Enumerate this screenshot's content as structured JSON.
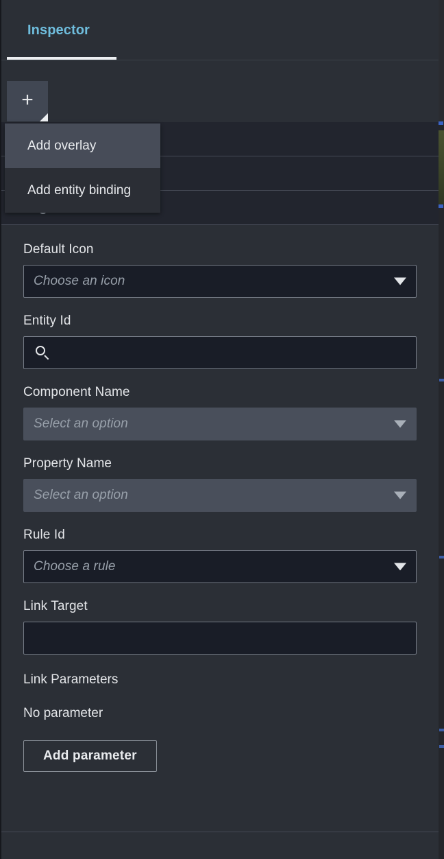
{
  "panel": {
    "tabs": [
      {
        "label": "Inspector",
        "selected": true
      }
    ],
    "toolbar": {
      "add_button_glyph": "+",
      "add_button_name": "add-button"
    },
    "menu": {
      "items": [
        {
          "label": "Add overlay",
          "hover": true
        },
        {
          "label": "Add entity binding",
          "hover": false
        }
      ]
    },
    "sections": [
      {
        "title": "",
        "expanded": true
      },
      {
        "title": "",
        "expanded": true
      },
      {
        "title": "Tag",
        "expanded": true,
        "chevron": "▾"
      }
    ],
    "form": {
      "fields": [
        {
          "label": "Default Icon",
          "type": "select",
          "placeholder": "Choose an icon",
          "value": "",
          "disabled": false
        },
        {
          "label": "Entity Id",
          "type": "search",
          "placeholder": "",
          "value": "",
          "disabled": false,
          "icon": "search-icon"
        },
        {
          "label": "Component Name",
          "type": "select",
          "placeholder": "Select an option",
          "value": "",
          "disabled": true
        },
        {
          "label": "Property Name",
          "type": "select",
          "placeholder": "Select an option",
          "value": "",
          "disabled": true
        },
        {
          "label": "Rule Id",
          "type": "select",
          "placeholder": "Choose a rule",
          "value": "",
          "disabled": false
        },
        {
          "label": "Link Target",
          "type": "text",
          "placeholder": "",
          "value": "",
          "disabled": false
        }
      ],
      "link_parameters": {
        "label": "Link Parameters",
        "empty_text": "No parameter",
        "add_button_label": "Add parameter"
      }
    }
  },
  "colors": {
    "panel_bg": "#2b2f36",
    "section_bg": "#22252e",
    "input_bg": "#191d27",
    "disabled_bg": "#494f5b",
    "menu_bg": "#2b2e35",
    "menu_hover_bg": "#474c58",
    "tab_accent": "#6fbddd",
    "tab_underline": "#eceef1",
    "text_primary": "#e4e6e9",
    "text_muted": "#98a0aa",
    "border": "#757b86",
    "divider": "#454a55"
  }
}
